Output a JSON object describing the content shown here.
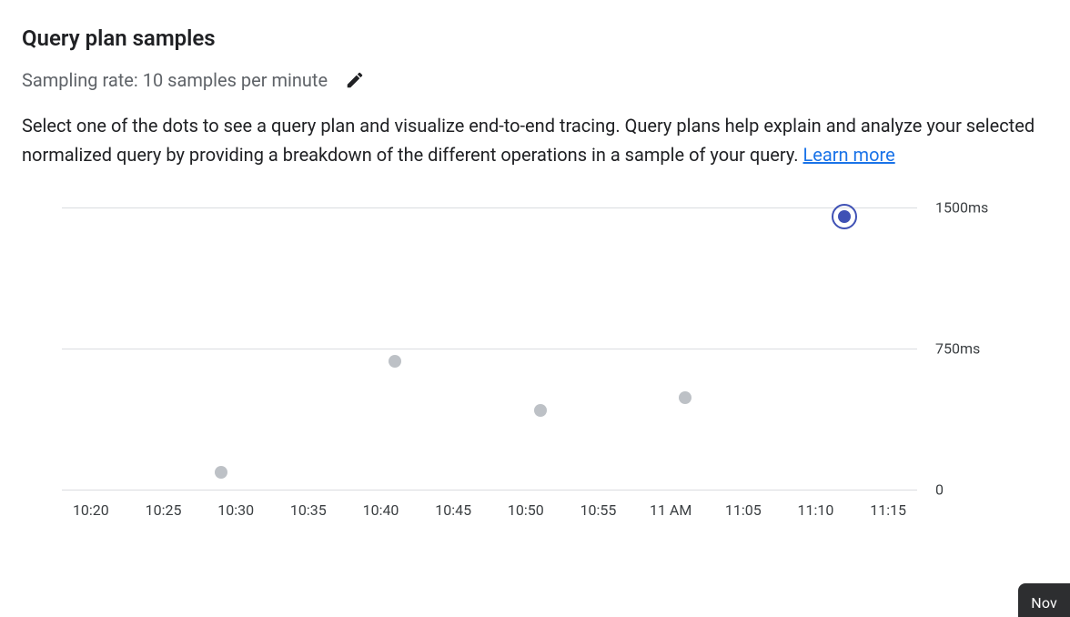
{
  "header": {
    "title": "Query plan samples",
    "sample_rate_text": "Sampling rate: 10 samples per minute",
    "edit_icon_name": "pencil-icon"
  },
  "description": {
    "body": "Select one of the dots to see a query plan and visualize end-to-end tracing. Query plans help explain and analyze your selected normalized query by providing a breakdown of the different operations in a sample of your query. ",
    "learn_more_label": "Learn more"
  },
  "chart_data": {
    "type": "scatter",
    "title": "",
    "xlabel": "",
    "ylabel": "",
    "y_ticks": [
      {
        "value": 0,
        "label": "0"
      },
      {
        "value": 750,
        "label": "750ms"
      },
      {
        "value": 1500,
        "label": "1500ms"
      }
    ],
    "ylim": [
      0,
      1500
    ],
    "x_ticks": [
      "10:20",
      "10:25",
      "10:30",
      "10:35",
      "10:40",
      "10:45",
      "10:50",
      "10:55",
      "11 AM",
      "11:05",
      "11:10",
      "11:15"
    ],
    "x_range_minutes": [
      18,
      77
    ],
    "series": [
      {
        "name": "samples",
        "points": [
          {
            "x_minute": 29,
            "x_label": "10:29",
            "y_ms": 90,
            "selected": false
          },
          {
            "x_minute": 41,
            "x_label": "10:41",
            "y_ms": 680,
            "selected": false
          },
          {
            "x_minute": 51,
            "x_label": "10:51",
            "y_ms": 420,
            "selected": false
          },
          {
            "x_minute": 61,
            "x_label": "11:01",
            "y_ms": 490,
            "selected": false
          },
          {
            "x_minute": 72,
            "x_label": "11:12",
            "y_ms": 1450,
            "selected": true
          }
        ]
      }
    ]
  },
  "corner_panel": {
    "label_fragment": "Nov"
  }
}
